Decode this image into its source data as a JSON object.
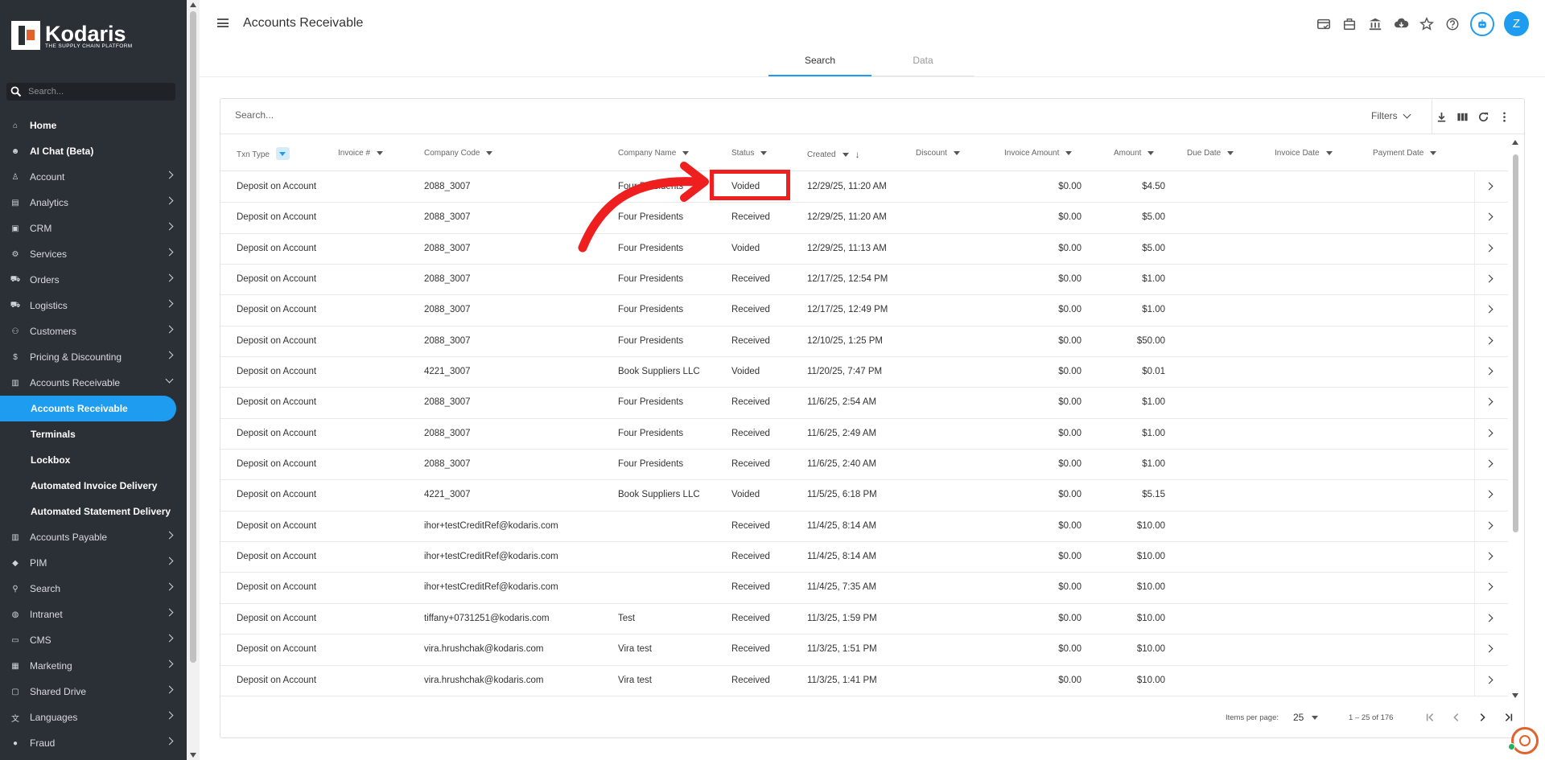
{
  "brand": {
    "name": "Kodaris",
    "tagline": "THE SUPPLY CHAIN PLATFORM",
    "accent": "#1e9cf0",
    "logo_accent": "#e2622b"
  },
  "sidebar": {
    "search_placeholder": "Search...",
    "items": [
      {
        "label": "Home",
        "icon": "home-icon",
        "glyph": "⌂",
        "strong": true,
        "chevron": ""
      },
      {
        "label": "AI Chat (Beta)",
        "icon": "robot-icon",
        "glyph": "☻",
        "strong": true,
        "chevron": ""
      },
      {
        "label": "Account",
        "icon": "person-icon",
        "glyph": "♙",
        "strong": false,
        "chevron": "right"
      },
      {
        "label": "Analytics",
        "icon": "analytics-icon",
        "glyph": "▤",
        "strong": false,
        "chevron": "right"
      },
      {
        "label": "CRM",
        "icon": "contact-card-icon",
        "glyph": "▣",
        "strong": false,
        "chevron": "right"
      },
      {
        "label": "Services",
        "icon": "services-icon",
        "glyph": "⚙",
        "strong": false,
        "chevron": "right"
      },
      {
        "label": "Orders",
        "icon": "car-icon",
        "glyph": "⛟",
        "strong": false,
        "chevron": "right"
      },
      {
        "label": "Logistics",
        "icon": "truck-icon",
        "glyph": "⛟",
        "strong": false,
        "chevron": "right"
      },
      {
        "label": "Customers",
        "icon": "people-icon",
        "glyph": "⚇",
        "strong": false,
        "chevron": "right"
      },
      {
        "label": "Pricing & Discounting",
        "icon": "dollar-icon",
        "glyph": "$",
        "strong": false,
        "chevron": "right"
      },
      {
        "label": "Accounts Receivable",
        "icon": "bank-icon",
        "glyph": "▥",
        "strong": false,
        "chevron": "down"
      }
    ],
    "sub_items": [
      {
        "label": "Accounts Receivable",
        "active": true
      },
      {
        "label": "Terminals",
        "active": false
      },
      {
        "label": "Lockbox",
        "active": false
      },
      {
        "label": "Automated Invoice Delivery",
        "active": false
      },
      {
        "label": "Automated Statement Delivery",
        "active": false
      }
    ],
    "items_after": [
      {
        "label": "Accounts Payable",
        "icon": "bank-icon",
        "glyph": "▥",
        "chevron": "right"
      },
      {
        "label": "PIM",
        "icon": "tag-icon",
        "glyph": "◆",
        "chevron": "right"
      },
      {
        "label": "Search",
        "icon": "search-icon",
        "glyph": "⚲",
        "chevron": "right"
      },
      {
        "label": "Intranet",
        "icon": "globe-icon",
        "glyph": "◍",
        "chevron": "right"
      },
      {
        "label": "CMS",
        "icon": "cms-icon",
        "glyph": "▭",
        "chevron": "right"
      },
      {
        "label": "Marketing",
        "icon": "newspaper-icon",
        "glyph": "▦",
        "chevron": "right"
      },
      {
        "label": "Shared Drive",
        "icon": "folder-icon",
        "glyph": "▢",
        "chevron": "right"
      },
      {
        "label": "Languages",
        "icon": "translate-icon",
        "glyph": "文",
        "chevron": "right"
      },
      {
        "label": "Fraud",
        "icon": "alert-icon",
        "glyph": "●",
        "chevron": "right"
      }
    ]
  },
  "header": {
    "title": "Accounts Receivable",
    "avatar_initial": "Z",
    "icons": [
      "card-check-icon",
      "briefcase-icon",
      "bank-icon",
      "cloud-download-icon",
      "star-icon",
      "help-icon",
      "robot-icon"
    ]
  },
  "tabs": [
    {
      "label": "Search",
      "active": true
    },
    {
      "label": "Data",
      "active": false
    }
  ],
  "toolbar": {
    "search_placeholder": "Search...",
    "filters_label": "Filters"
  },
  "table": {
    "columns": [
      "Txn Type",
      "Invoice #",
      "Company Code",
      "Company Name",
      "Status",
      "Created",
      "Discount",
      "Invoice Amount",
      "Amount",
      "Due Date",
      "Invoice Date",
      "Payment Date"
    ],
    "rows": [
      [
        "Deposit on Account",
        "",
        "2088_3007",
        "Four Presidents",
        "Voided",
        "12/29/25, 11:20 AM",
        "",
        "$0.00",
        "$4.50",
        "",
        "",
        ""
      ],
      [
        "Deposit on Account",
        "",
        "2088_3007",
        "Four Presidents",
        "Received",
        "12/29/25, 11:20 AM",
        "",
        "$0.00",
        "$5.00",
        "",
        "",
        ""
      ],
      [
        "Deposit on Account",
        "",
        "2088_3007",
        "Four Presidents",
        "Voided",
        "12/29/25, 11:13 AM",
        "",
        "$0.00",
        "$5.00",
        "",
        "",
        ""
      ],
      [
        "Deposit on Account",
        "",
        "2088_3007",
        "Four Presidents",
        "Received",
        "12/17/25, 12:54 PM",
        "",
        "$0.00",
        "$1.00",
        "",
        "",
        ""
      ],
      [
        "Deposit on Account",
        "",
        "2088_3007",
        "Four Presidents",
        "Received",
        "12/17/25, 12:49 PM",
        "",
        "$0.00",
        "$1.00",
        "",
        "",
        ""
      ],
      [
        "Deposit on Account",
        "",
        "2088_3007",
        "Four Presidents",
        "Received",
        "12/10/25, 1:25 PM",
        "",
        "$0.00",
        "$50.00",
        "",
        "",
        ""
      ],
      [
        "Deposit on Account",
        "",
        "4221_3007",
        "Book Suppliers LLC",
        "Voided",
        "11/20/25, 7:47 PM",
        "",
        "$0.00",
        "$0.01",
        "",
        "",
        ""
      ],
      [
        "Deposit on Account",
        "",
        "2088_3007",
        "Four Presidents",
        "Received",
        "11/6/25, 2:54 AM",
        "",
        "$0.00",
        "$1.00",
        "",
        "",
        ""
      ],
      [
        "Deposit on Account",
        "",
        "2088_3007",
        "Four Presidents",
        "Received",
        "11/6/25, 2:49 AM",
        "",
        "$0.00",
        "$1.00",
        "",
        "",
        ""
      ],
      [
        "Deposit on Account",
        "",
        "2088_3007",
        "Four Presidents",
        "Received",
        "11/6/25, 2:40 AM",
        "",
        "$0.00",
        "$1.00",
        "",
        "",
        ""
      ],
      [
        "Deposit on Account",
        "",
        "4221_3007",
        "Book Suppliers LLC",
        "Voided",
        "11/5/25, 6:18 PM",
        "",
        "$0.00",
        "$5.15",
        "",
        "",
        ""
      ],
      [
        "Deposit on Account",
        "",
        "ihor+testCreditRef@kodaris.com",
        "",
        "Received",
        "11/4/25, 8:14 AM",
        "",
        "$0.00",
        "$10.00",
        "",
        "",
        ""
      ],
      [
        "Deposit on Account",
        "",
        "ihor+testCreditRef@kodaris.com",
        "",
        "Received",
        "11/4/25, 8:14 AM",
        "",
        "$0.00",
        "$10.00",
        "",
        "",
        ""
      ],
      [
        "Deposit on Account",
        "",
        "ihor+testCreditRef@kodaris.com",
        "",
        "Received",
        "11/4/25, 7:35 AM",
        "",
        "$0.00",
        "$10.00",
        "",
        "",
        ""
      ],
      [
        "Deposit on Account",
        "",
        "tiffany+0731251@kodaris.com",
        "Test",
        "Received",
        "11/3/25, 1:59 PM",
        "",
        "$0.00",
        "$10.00",
        "",
        "",
        ""
      ],
      [
        "Deposit on Account",
        "",
        "vira.hrushchak@kodaris.com",
        "Vira test",
        "Received",
        "11/3/25, 1:51 PM",
        "",
        "$0.00",
        "$10.00",
        "",
        "",
        ""
      ],
      [
        "Deposit on Account",
        "",
        "vira.hrushchak@kodaris.com",
        "Vira test",
        "Received",
        "11/3/25, 1:41 PM",
        "",
        "$0.00",
        "$10.00",
        "",
        "",
        ""
      ]
    ]
  },
  "pager": {
    "label": "Items per page:",
    "per_page": "25",
    "range": "1 – 25 of 176"
  },
  "annotation": {
    "color": "#ef1f1f"
  }
}
